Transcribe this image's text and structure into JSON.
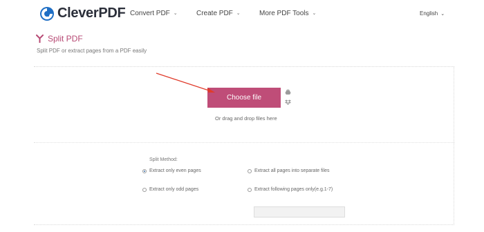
{
  "header": {
    "logo_text": "CleverPDF",
    "nav": [
      {
        "label": "Convert PDF"
      },
      {
        "label": "Create PDF"
      },
      {
        "label": "More PDF Tools"
      }
    ],
    "language": "English"
  },
  "page": {
    "title": "Split PDF",
    "subtitle": "Split PDF or extract pages from a PDF easily"
  },
  "upload": {
    "choose_label": "Choose file",
    "drop_text": "Or drag and drop files here",
    "icons": [
      "google-drive-icon",
      "dropbox-icon"
    ]
  },
  "split": {
    "method_label": "Split Method:",
    "options": [
      {
        "label": "Extract only even pages",
        "selected": true
      },
      {
        "label": "Extract only odd pages",
        "selected": false
      },
      {
        "label": "Extract all pages into separate files",
        "selected": false
      },
      {
        "label": "Extract following pages only(e.g.1-7)",
        "selected": false
      }
    ],
    "pages_value": ""
  },
  "colors": {
    "accent": "#bf4d78",
    "title": "#b74a74",
    "logo_blue": "#1f6fc5",
    "annotation_arrow": "#e03b2b"
  }
}
